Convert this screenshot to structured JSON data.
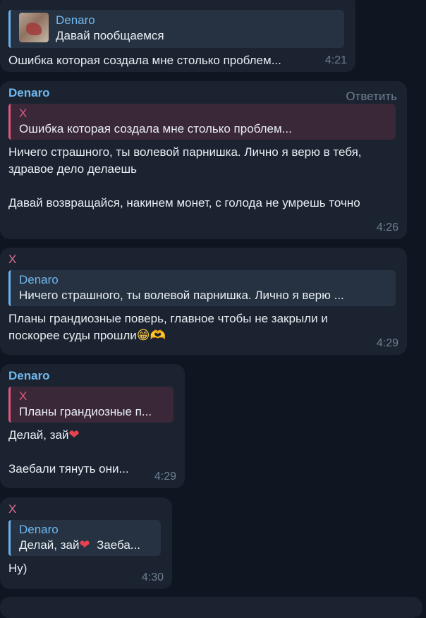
{
  "messages": [
    {
      "quote_name": "Denaro",
      "quote_text": "Давай пообщаемся",
      "text": "Ошибка которая создала мне столько проблем...",
      "time": "4:21"
    },
    {
      "sender": "Denaro",
      "reply_label": "Ответить",
      "quote_name": "X",
      "quote_text": "Ошибка которая создала мне столько проблем...",
      "text": "Ничего страшного, ты волевой парнишка. Лично я верю в тебя, здравое дело делаешь\n\nДавай возвращайся, накинем монет, с голода не умрешь точно",
      "time": "4:26"
    },
    {
      "sender": "X",
      "quote_name": "Denaro",
      "quote_text": "Ничего страшного, ты волевой парнишка. Лично я верю ...",
      "text_line1": "Планы грандиозные поверь, главное чтобы не закрыли и",
      "text_line2": "поскорее суды прошли",
      "emoji1": "😁",
      "emoji2": "🫶",
      "time": "4:29"
    },
    {
      "sender": "Denaro",
      "quote_name": "X",
      "quote_text": "Планы грандиозные п...",
      "text_line1": "Делай, зай",
      "emoji1": "❤",
      "text_line2": "Заебали тянуть они...",
      "time": "4:29"
    },
    {
      "sender": "X",
      "quote_name": "Denaro",
      "quote_text_a": "Делай, зай",
      "quote_emoji": "❤",
      "quote_text_b": "  Заеба...",
      "text": "Ну)",
      "time": "4:30"
    }
  ]
}
